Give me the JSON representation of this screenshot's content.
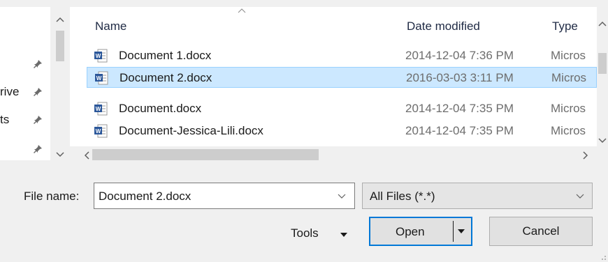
{
  "nav": {
    "items": [
      {
        "label": "s",
        "pinned": false
      },
      {
        "label": "",
        "pinned": true
      },
      {
        "label": "rive",
        "pinned": true
      },
      {
        "label": "ts",
        "pinned": true
      },
      {
        "label": "",
        "pinned": true
      }
    ]
  },
  "columns": {
    "name": "Name",
    "date": "Date modified",
    "type": "Type"
  },
  "files": [
    {
      "name": "Document 1.docx",
      "date": "2014-12-04 7:36 PM",
      "type": "Micros",
      "selected": false
    },
    {
      "name": "Document 2.docx",
      "date": "2016-03-03 3:11 PM",
      "type": "Micros",
      "selected": true
    },
    {
      "name": "Document.docx",
      "date": "2014-12-04 7:35 PM",
      "type": "Micros",
      "selected": false
    },
    {
      "name": "Document-Jessica-Lili.docx",
      "date": "2014-12-04 7:35 PM",
      "type": "Micros",
      "selected": false
    }
  ],
  "bottom": {
    "file_name_label": "File name:",
    "file_name_value": "Document 2.docx",
    "filter_value": "All Files (*.*)",
    "tools_label": "Tools",
    "open_label": "Open",
    "cancel_label": "Cancel"
  },
  "colors": {
    "selection": "#cce8ff",
    "accent": "#0078d7",
    "word_icon": "#2b579a"
  }
}
